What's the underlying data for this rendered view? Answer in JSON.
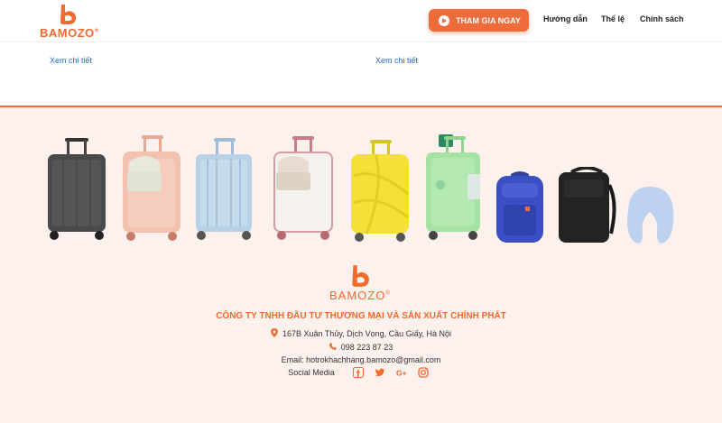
{
  "brand": {
    "name": "BAMOZO",
    "trademark": "®",
    "color": "#f26a2e"
  },
  "header": {
    "cta_label": "THAM GIA NGAY",
    "nav": [
      "Hướng dẫn",
      "Thể lệ",
      "Chính sách"
    ]
  },
  "content": {
    "detail_links": [
      "Xem chi tiết",
      "Xem chi tiết"
    ]
  },
  "footer": {
    "products": [
      {
        "name": "suitcase-dark-gray",
        "icon": "suitcase-icon"
      },
      {
        "name": "suitcase-peach-with-bag",
        "icon": "suitcase-icon"
      },
      {
        "name": "suitcase-light-blue",
        "icon": "suitcase-icon"
      },
      {
        "name": "suitcase-white-with-bag",
        "icon": "suitcase-icon"
      },
      {
        "name": "suitcase-yellow",
        "icon": "suitcase-icon"
      },
      {
        "name": "suitcase-green",
        "icon": "suitcase-icon"
      },
      {
        "name": "backpack-blue",
        "icon": "backpack-icon"
      },
      {
        "name": "backpack-black",
        "icon": "backpack-icon"
      },
      {
        "name": "neck-pillow-light-blue",
        "icon": "pillow-icon"
      }
    ],
    "company": "CÔNG TY TNHH ĐẦU TƯ THƯƠNG MẠI VÀ SẢN XUẤT CHÍNH PHÁT",
    "address": "167B Xuân Thủy, Dịch Vọng, Cầu Giấy, Hà Nội",
    "phone": "098 223 87 23",
    "email_label": "Email: hotrokhachhang.bamozo@gmail.com",
    "social_label": "Social Media",
    "social_icons": [
      "facebook-icon",
      "twitter-icon",
      "google-plus-icon",
      "instagram-icon"
    ]
  }
}
